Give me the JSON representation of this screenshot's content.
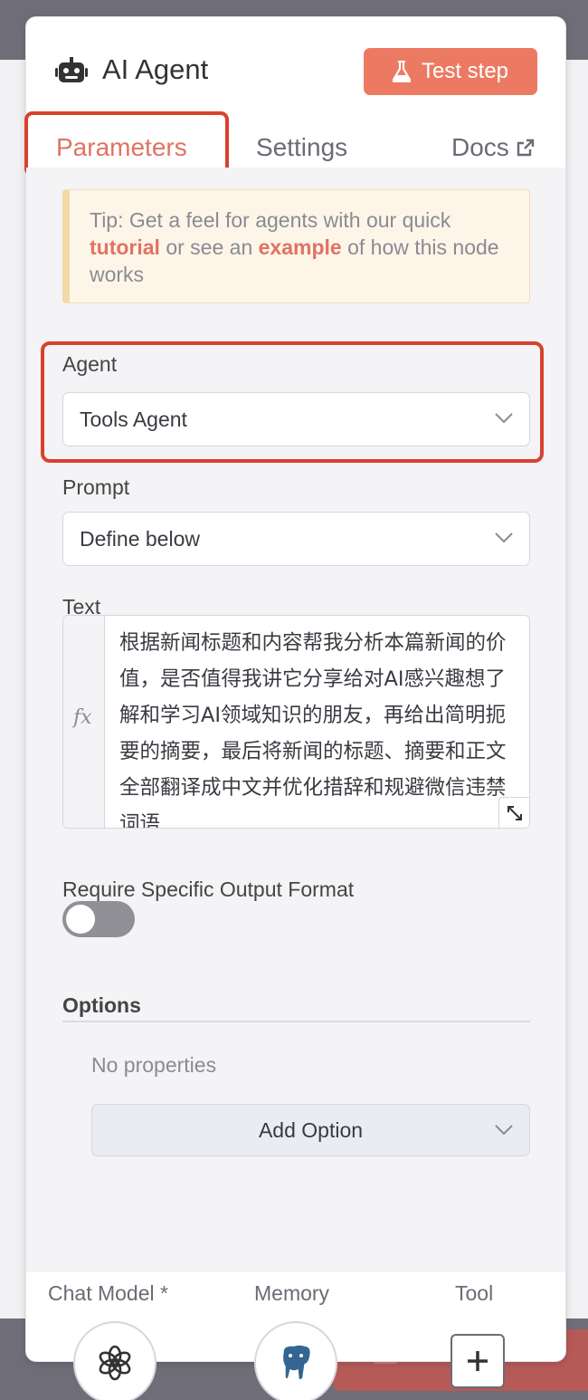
{
  "header": {
    "title": "AI Agent",
    "test_step_label": "Test step"
  },
  "tabs": [
    {
      "label": "Parameters",
      "active": true
    },
    {
      "label": "Settings",
      "active": false
    },
    {
      "label": "Docs",
      "active": false
    }
  ],
  "tip": {
    "prefix": "Tip: Get a feel for agents with our quick",
    "link1": "tutorial",
    "middle": "or see an",
    "link2": "example",
    "suffix": "of how this node works"
  },
  "fields": {
    "agent_label": "Agent",
    "agent_value": "Tools Agent",
    "prompt_label": "Prompt",
    "prompt_value": "Define below",
    "text_label": "Text",
    "text_value": "根据新闻标题和内容帮我分析本篇新闻的价值，是否值得我讲它分享给对AI感兴趣想了解和学习AI领域知识的朋友，再给出简明扼要的摘要，最后将新闻的标题、摘要和正文全部翻译成中文并优化措辞和规避微信违禁词语",
    "fx_label": "fx",
    "output_format_label": "Require Specific Output Format",
    "output_format_enabled": false
  },
  "options": {
    "title": "Options",
    "empty_text": "No properties",
    "add_label": "Add Option"
  },
  "footer": {
    "chat_model_label": "Chat Model *",
    "memory_label": "Memory",
    "tool_label": "Tool"
  },
  "colors": {
    "accent": "#ec7a62",
    "highlight": "#d9412e"
  }
}
